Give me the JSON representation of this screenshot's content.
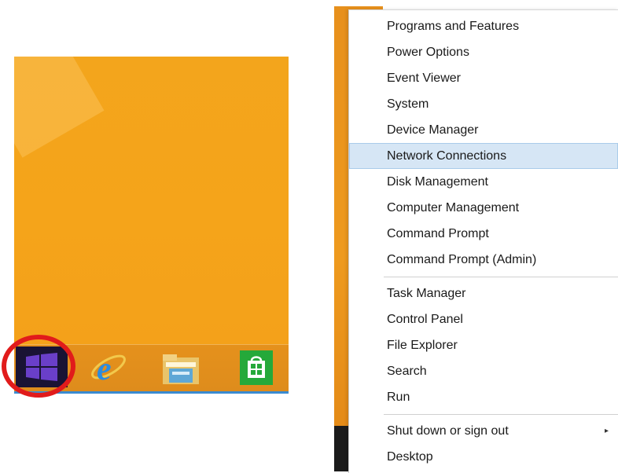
{
  "taskbar": {
    "icons": [
      "windows-logo-icon",
      "internet-explorer-icon",
      "file-explorer-icon",
      "store-icon"
    ],
    "highlight_color": "#e11b1b",
    "start_tile_color": "#1a1334",
    "desktop_color": "#f5a41a"
  },
  "menu": {
    "items": [
      {
        "label": "Programs and Features"
      },
      {
        "label": "Power Options"
      },
      {
        "label": "Event Viewer"
      },
      {
        "label": "System"
      },
      {
        "label": "Device Manager"
      },
      {
        "label": "Network Connections",
        "selected": true
      },
      {
        "label": "Disk Management"
      },
      {
        "label": "Computer Management"
      },
      {
        "label": "Command Prompt"
      },
      {
        "label": "Command Prompt (Admin)"
      },
      {
        "label": "Task Manager"
      },
      {
        "label": "Control Panel"
      },
      {
        "label": "File Explorer"
      },
      {
        "label": "Search"
      },
      {
        "label": "Run"
      },
      {
        "label": "Shut down or sign out",
        "has_submenu": true
      },
      {
        "label": "Desktop"
      }
    ],
    "submenu_arrow": "▸",
    "selected_color": "#d6e6f5"
  }
}
